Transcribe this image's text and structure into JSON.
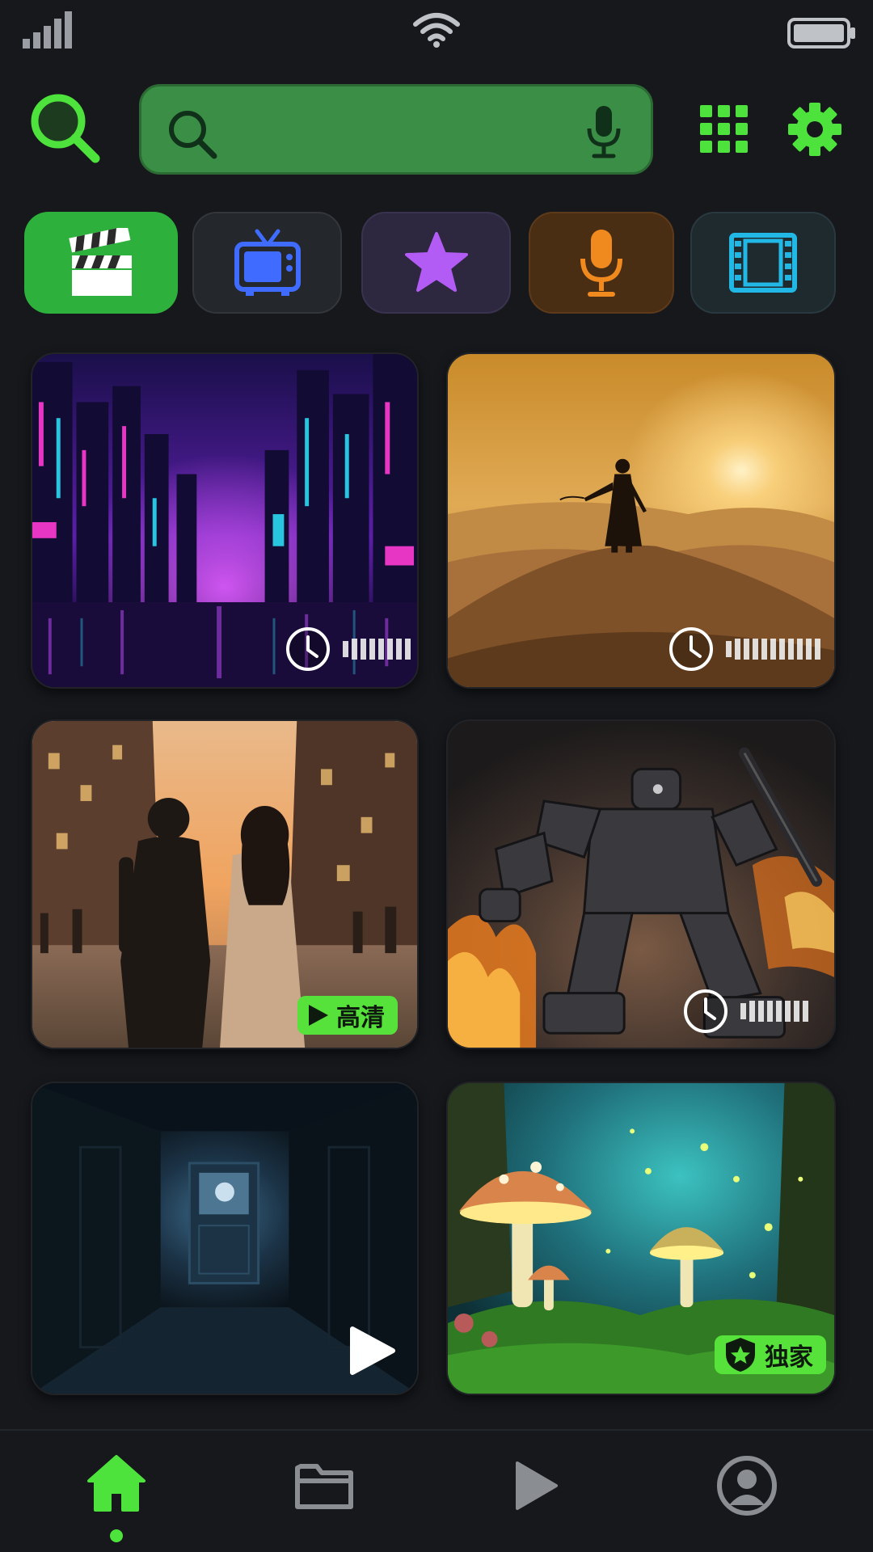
{
  "theme": {
    "accent": "#4ee23c",
    "background": "#16181c",
    "search_bg": "#3a8e45"
  },
  "status_bar": {
    "icons": [
      "signal-icon",
      "wifi-icon",
      "battery-icon"
    ]
  },
  "header": {
    "search_placeholder": "",
    "search_value": "",
    "icons": [
      "search-icon",
      "mic-icon",
      "grid-icon",
      "gear-icon"
    ]
  },
  "categories": [
    {
      "icon": "clapperboard-icon",
      "selected": true,
      "color": "#2eb03c"
    },
    {
      "icon": "tv-icon",
      "selected": false,
      "color": "#3f6bff"
    },
    {
      "icon": "star-icon",
      "selected": false,
      "color": "#b35bf5"
    },
    {
      "icon": "microphone-icon",
      "selected": false,
      "color": "#f08a1e"
    },
    {
      "icon": "film-icon",
      "selected": false,
      "color": "#22b8e6"
    }
  ],
  "cards": [
    {
      "scene": "neon-city",
      "overlay": "clock-and-duration"
    },
    {
      "scene": "desert-warrior",
      "overlay": "clock-and-duration"
    },
    {
      "scene": "couple-street",
      "badge": "高清",
      "badge_icon": "play-icon"
    },
    {
      "scene": "battle-robot",
      "overlay": "clock-and-duration"
    },
    {
      "scene": "dark-corridor",
      "overlay": "play-icon"
    },
    {
      "scene": "mushroom-forest",
      "badge": "独家",
      "badge_icon": "shield-star-icon"
    }
  ],
  "bottom_nav": [
    {
      "icon": "home-icon",
      "active": true
    },
    {
      "icon": "folder-icon",
      "active": false
    },
    {
      "icon": "play-icon",
      "active": false
    },
    {
      "icon": "profile-icon",
      "active": false
    }
  ]
}
